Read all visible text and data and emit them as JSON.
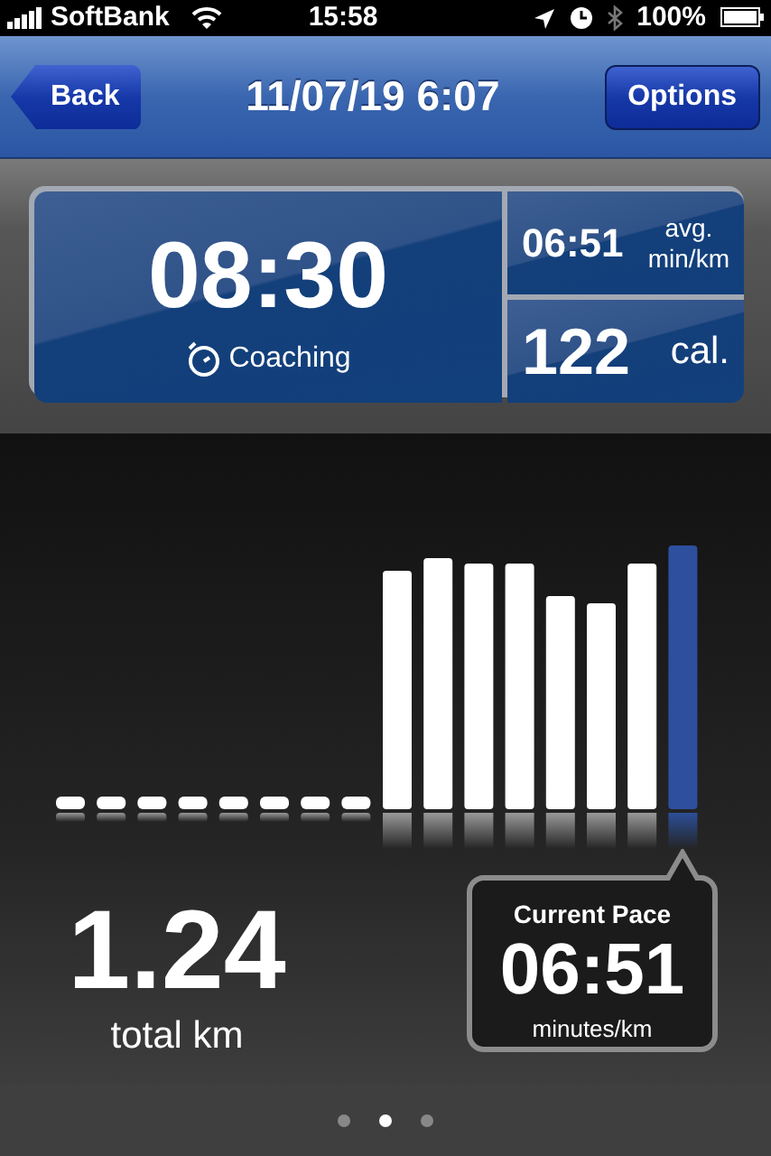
{
  "status_bar": {
    "carrier": "SoftBank",
    "time": "15:58",
    "battery": "100%"
  },
  "nav": {
    "back": "Back",
    "title": "11/07/19 6:07",
    "options": "Options"
  },
  "summary": {
    "duration": "08:30",
    "mode": "Coaching",
    "avg_pace": "06:51",
    "avg_label": "avg.",
    "avg_unit": "min/km",
    "calories": "122",
    "calories_unit": "cal."
  },
  "distance": {
    "value": "1.24",
    "label": "total km"
  },
  "current_pace": {
    "title": "Current Pace",
    "value": "06:51",
    "unit": "minutes/km"
  },
  "pages": [
    {
      "selected": false
    },
    {
      "selected": true
    },
    {
      "selected": false
    }
  ]
}
